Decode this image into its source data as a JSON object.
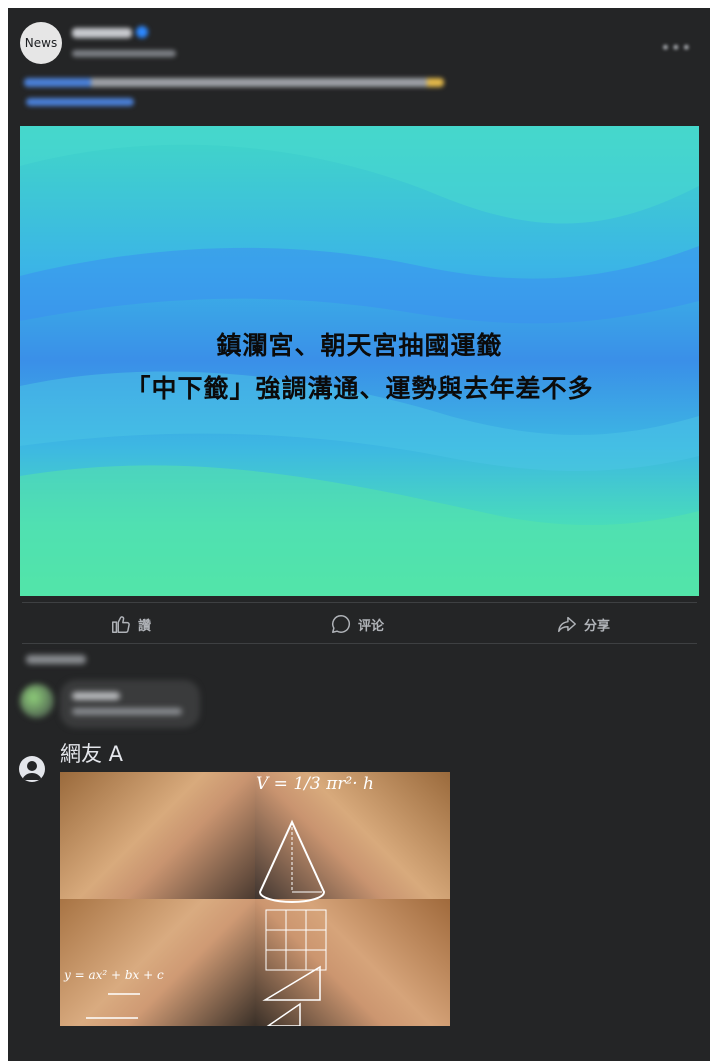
{
  "post": {
    "page_avatar_label": "News",
    "hero_title_line1": "鎮瀾宮、朝天宮抽國運籤",
    "hero_title_line2": "「中下籤」強調溝通、運勢與去年差不多"
  },
  "actions": {
    "like_label": "讚",
    "comment_label": "评论",
    "share_label": "分享"
  },
  "comment": {
    "author": "網友 A",
    "meme_formula_volume": "V = 1/3 πr²· h",
    "meme_formula_quadratic": "y = ax² + bx + c"
  },
  "colors": {
    "panel_bg": "#242526",
    "text_primary": "#e4e6eb",
    "text_secondary": "#b0b3b8",
    "divider": "#3e4042"
  }
}
